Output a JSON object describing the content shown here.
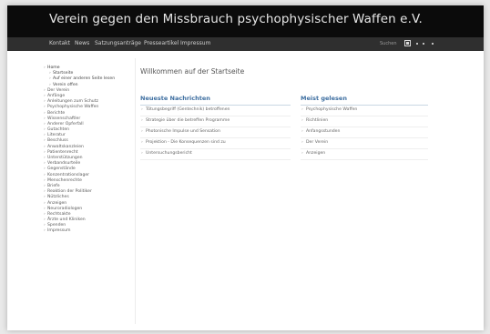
{
  "site_title": "Verein gegen den Missbrauch psychophysischer Waffen e.V.",
  "nav": [
    "Kontakt",
    "News",
    "Satzungsanträge",
    "Presseartikel",
    "Impressum"
  ],
  "nav_search": "Suchen",
  "sidebar": {
    "items": [
      {
        "label": "Home",
        "sub": false,
        "home": true
      },
      {
        "label": "Startseite",
        "sub": true
      },
      {
        "label": "Auf einer anderen Seite lesen",
        "sub": true
      },
      {
        "label": "Verein offen",
        "sub": true
      },
      {
        "label": "Der Verein",
        "sub": false
      },
      {
        "label": "Anfänge",
        "sub": false
      },
      {
        "label": "Anleitungen zum Schutz",
        "sub": false
      },
      {
        "label": "Psychophysische Waffen",
        "sub": false
      },
      {
        "label": "Berichte",
        "sub": false
      },
      {
        "label": "Wissenschaftler",
        "sub": false
      },
      {
        "label": "Anderer Opferfall",
        "sub": false
      },
      {
        "label": "Gutachten",
        "sub": false
      },
      {
        "label": "Literatur",
        "sub": false
      },
      {
        "label": "Beschluss",
        "sub": false
      },
      {
        "label": "Anwaltskanzleien",
        "sub": false
      },
      {
        "label": "Patientenrecht",
        "sub": false
      },
      {
        "label": "Unterstützungen",
        "sub": false
      },
      {
        "label": "Verbandsurteile",
        "sub": false
      },
      {
        "label": "Gegenstände",
        "sub": false
      },
      {
        "label": "Konzentrationslager",
        "sub": false
      },
      {
        "label": "Menschenrechte",
        "sub": false
      },
      {
        "label": "Briefe",
        "sub": false
      },
      {
        "label": "Reaktion der Politiker",
        "sub": false
      },
      {
        "label": "Nützliches",
        "sub": false
      },
      {
        "label": "Anzeigen",
        "sub": false
      },
      {
        "label": "Neuroradiologen",
        "sub": false
      },
      {
        "label": "Rechtsakte",
        "sub": false
      },
      {
        "label": "Ärzte und Kliniken",
        "sub": false
      },
      {
        "label": "Spenden",
        "sub": false
      },
      {
        "label": "Impressum",
        "sub": false
      }
    ]
  },
  "main": {
    "welcome": "Willkommen auf der Startseite",
    "news": {
      "heading": "Neueste Nachrichten",
      "items": [
        "Tötungsbegriff (Gentechnik) betroffenen",
        "Strategie über die betreffen Programme",
        "Photonische Impulse und Sensation",
        "Projektion - Die Konsequenzen sind zu",
        "Untersuchungsbericht"
      ]
    },
    "popular": {
      "heading": "Meist gelesen",
      "items": [
        "Psychophysische Waffen",
        "Richtlinien",
        "Anfangsstunden",
        "Der Verein",
        "Anzeigen"
      ]
    }
  }
}
